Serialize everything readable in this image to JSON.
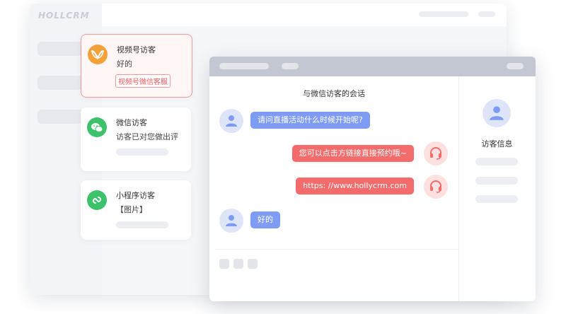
{
  "app": {
    "logo": "HOLLCRM"
  },
  "colors": {
    "accent_red": "#f36b6b",
    "accent_blue": "#7f9cf5",
    "wechat_green": "#3cc26b",
    "channels_orange": "#f5a13a"
  },
  "conversations": [
    {
      "title": "视频号访客",
      "message": "好的",
      "tag": "视频号微信客服",
      "icon": "channels-icon",
      "active": true
    },
    {
      "title": "微信访客",
      "message": "访客已对您做出评",
      "icon": "wechat-icon",
      "active": false
    },
    {
      "title": "小程序访客",
      "message": "【图片】",
      "icon": "mini-program-icon",
      "active": false
    }
  ],
  "chat": {
    "title": "与微信访客的会话",
    "messages": [
      {
        "from": "visitor",
        "text": "请问直播活动什么时候开始呢?"
      },
      {
        "from": "agent",
        "text": "您可以点击方链接直接预约哦~"
      },
      {
        "from": "agent",
        "text": "https: //www.hollycrm.com"
      },
      {
        "from": "visitor",
        "text": "好的"
      }
    ]
  },
  "visitor_panel": {
    "label": "访客信息"
  }
}
